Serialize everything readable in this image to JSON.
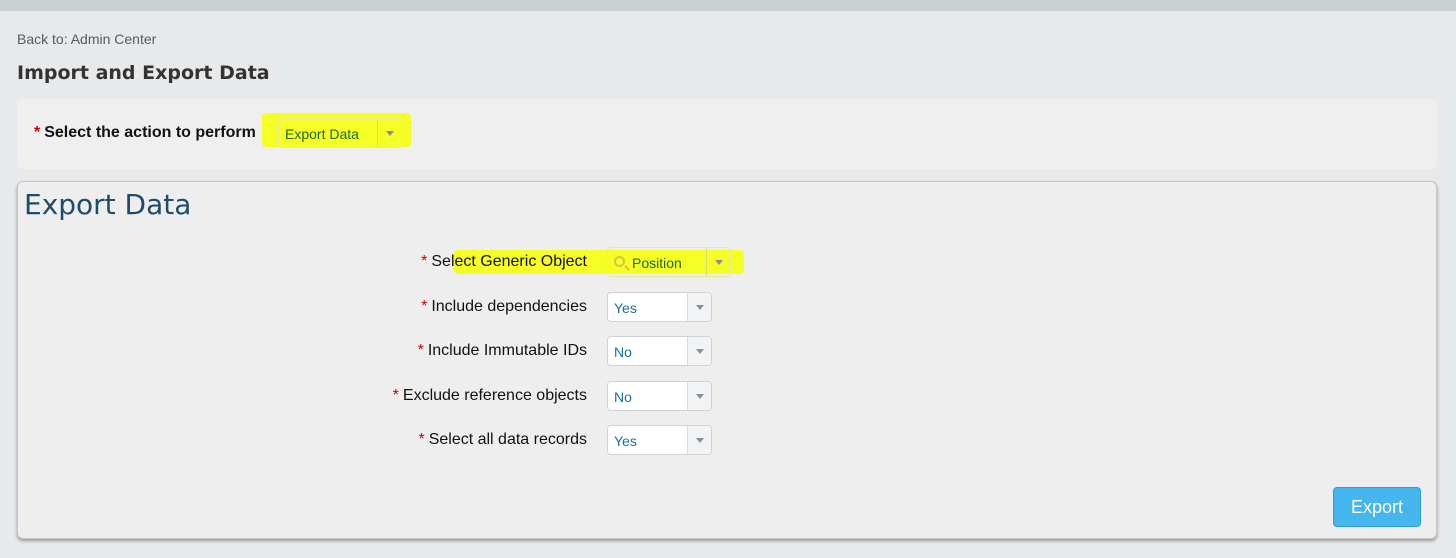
{
  "nav": {
    "back_link": "Back to: Admin Center"
  },
  "page": {
    "title": "Import and Export Data"
  },
  "action": {
    "required_mark": "*",
    "label": "Select the action to perform",
    "selected": "Export Data"
  },
  "export_panel": {
    "title": "Export Data",
    "fields": [
      {
        "required_mark": "*",
        "label": "Select Generic Object",
        "value": "Position",
        "icon": "search-icon"
      },
      {
        "required_mark": "*",
        "label": "Include dependencies",
        "value": "Yes"
      },
      {
        "required_mark": "*",
        "label": "Include Immutable IDs",
        "value": "No"
      },
      {
        "required_mark": "*",
        "label": "Exclude reference objects",
        "value": "No"
      },
      {
        "required_mark": "*",
        "label": "Select all data records",
        "value": "Yes"
      }
    ],
    "export_button": "Export"
  },
  "colors": {
    "highlight": "#f5ff14",
    "accent_button": "#45b6ee",
    "title_text": "#1e4d6b",
    "select_value": "#1a6f9a",
    "required": "#cc0000"
  }
}
